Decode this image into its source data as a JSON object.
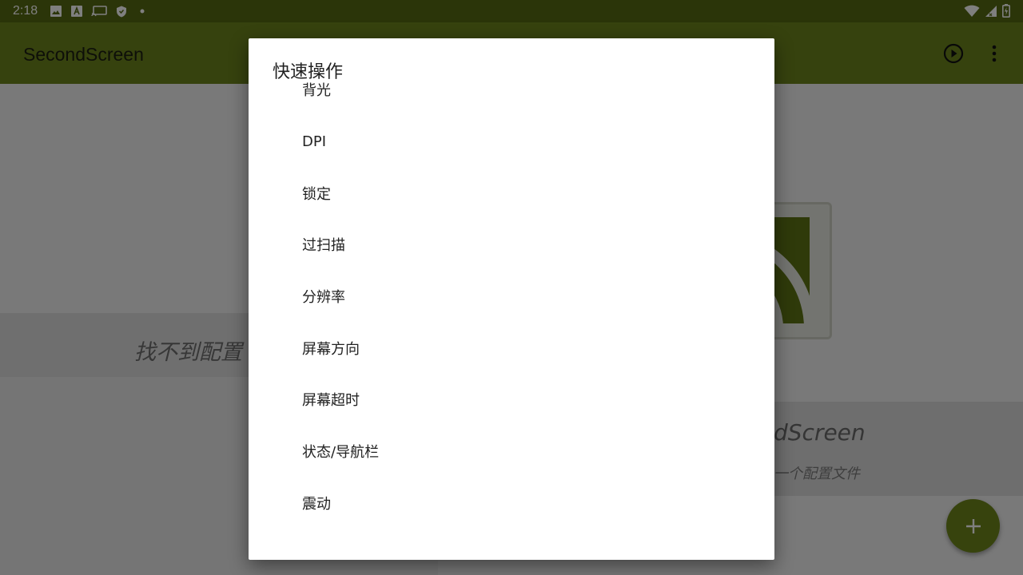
{
  "status_bar": {
    "time": "2:18",
    "left_icons": [
      "image-icon",
      "a-letter-icon",
      "cast-icon",
      "shield-icon",
      "dot-icon"
    ],
    "right_icons": [
      "wifi-icon",
      "cellular-signal-icon",
      "battery-icon"
    ],
    "background_color": "#566a12"
  },
  "app_bar": {
    "title": "SecondScreen",
    "actions": [
      "play-icon",
      "more-vert-icon"
    ],
    "background_color": "#6d851c"
  },
  "background": {
    "empty_left_text": "找不到配置",
    "empty_right_title": "dScreen",
    "empty_right_subtitle": "一个配置文件",
    "fab_icon": "add-icon",
    "accent_color": "#6e861a"
  },
  "dialog": {
    "title": "快速操作",
    "items": [
      {
        "label": "背光"
      },
      {
        "label": "DPI"
      },
      {
        "label": "锁定"
      },
      {
        "label": "过扫描"
      },
      {
        "label": "分辨率"
      },
      {
        "label": "屏幕方向"
      },
      {
        "label": "屏幕超时"
      },
      {
        "label": "状态/导航栏"
      },
      {
        "label": "震动"
      }
    ]
  }
}
